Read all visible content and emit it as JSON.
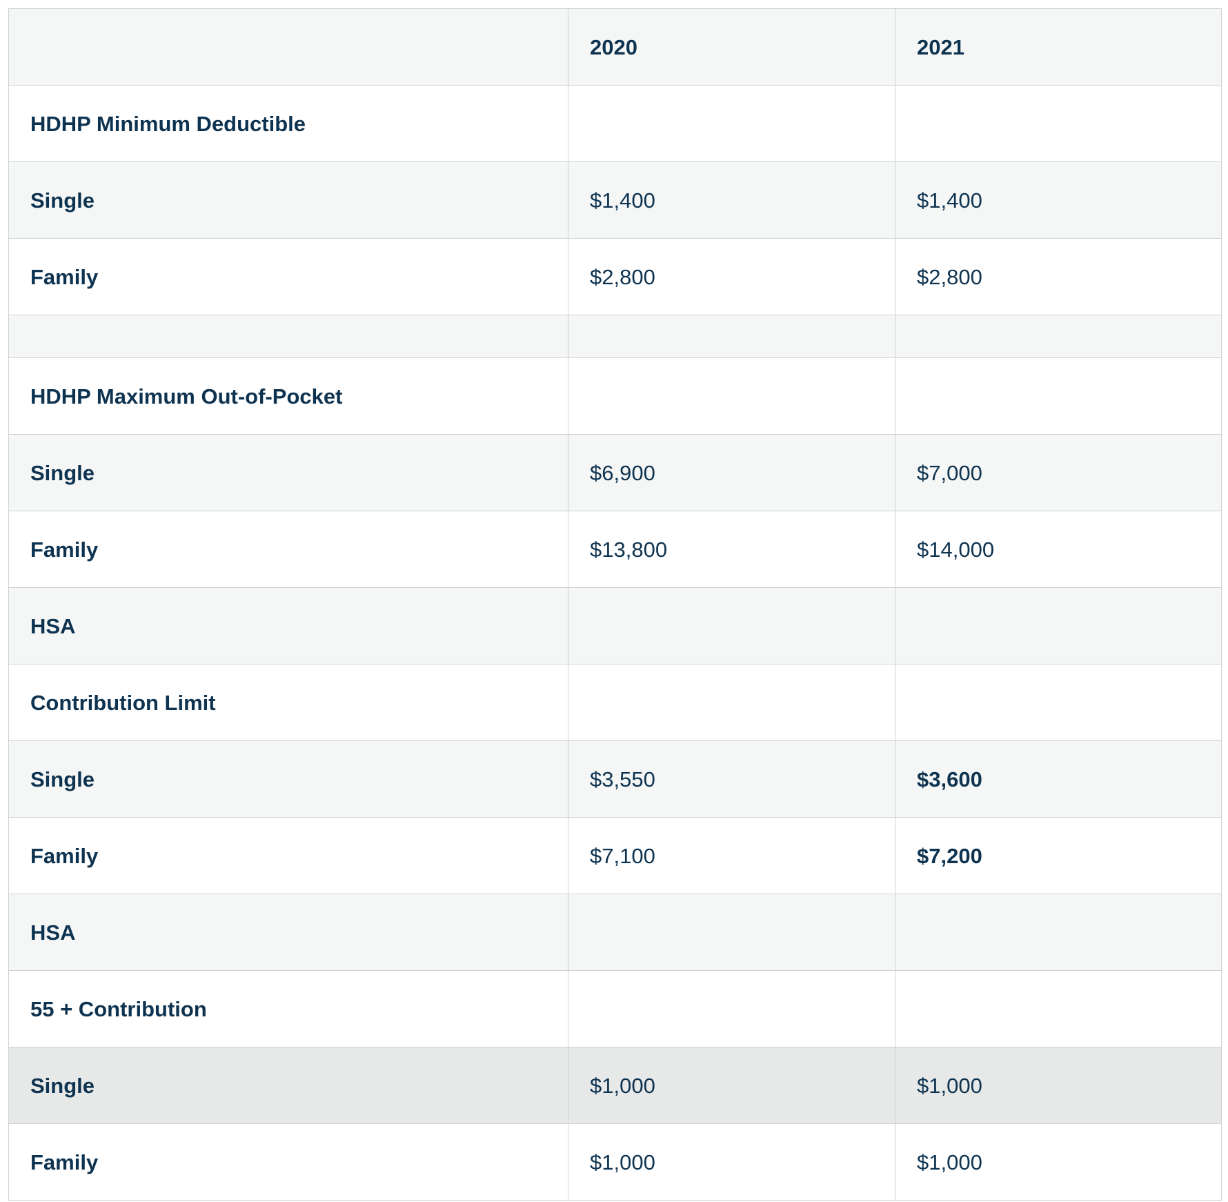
{
  "header": {
    "col0": "",
    "col1": "2020",
    "col2": "2021"
  },
  "rows": [
    {
      "label": "HDHP Minimum Deductible",
      "v2020": "",
      "v2021": ""
    },
    {
      "label": "Single",
      "v2020": "$1,400",
      "v2021": "$1,400"
    },
    {
      "label": "Family",
      "v2020": "$2,800",
      "v2021": "$2,800"
    },
    {
      "label": "",
      "v2020": "",
      "v2021": ""
    },
    {
      "label": "HDHP Maximum Out-of-Pocket",
      "v2020": "",
      "v2021": ""
    },
    {
      "label": "Single",
      "v2020": "$6,900",
      "v2021": "$7,000"
    },
    {
      "label": "Family",
      "v2020": "$13,800",
      "v2021": "$14,000"
    },
    {
      "label": "HSA",
      "v2020": "",
      "v2021": ""
    },
    {
      "label": "Contribution Limit",
      "v2020": "",
      "v2021": ""
    },
    {
      "label": "Single",
      "v2020": "$3,550",
      "v2021": "$3,600"
    },
    {
      "label": "Family",
      "v2020": "$7,100",
      "v2021": "$7,200"
    },
    {
      "label": "HSA",
      "v2020": "",
      "v2021": ""
    },
    {
      "label": "55 + Contribution",
      "v2020": "",
      "v2021": ""
    },
    {
      "label": "Single",
      "v2020": "$1,000",
      "v2021": "$1,000"
    },
    {
      "label": "Family",
      "v2020": "$1,000",
      "v2021": "$1,000"
    }
  ],
  "colors": {
    "text": "#0e3350",
    "border": "#cfd2d1",
    "stripe": "#f5f7f6",
    "highlight": "#e7e9e8"
  }
}
